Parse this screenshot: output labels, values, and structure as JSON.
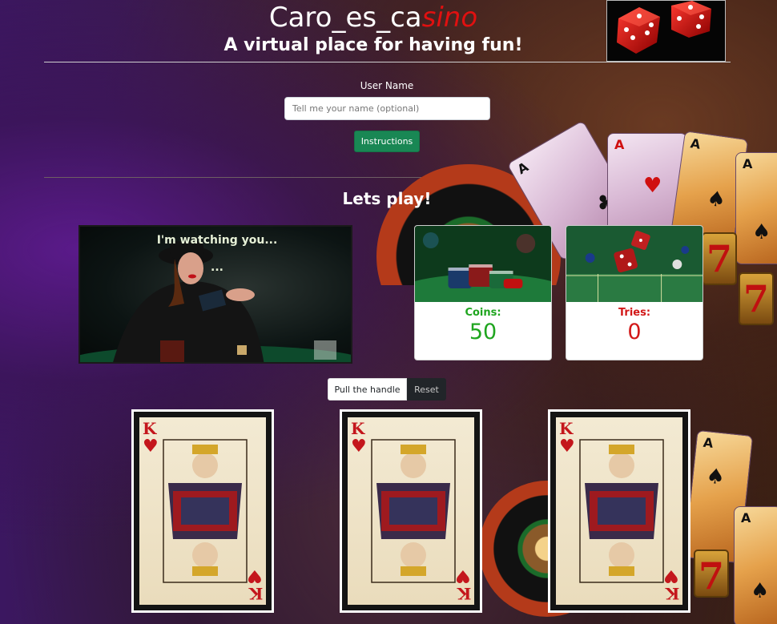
{
  "header": {
    "title_main": "Caro_es_ca",
    "title_accent": "sino",
    "subtitle": "A virtual place for having fun!"
  },
  "form": {
    "user_label": "User Name",
    "name_placeholder": "Tell me your name (optional)",
    "name_value": "",
    "instructions_button": "Instructions"
  },
  "game": {
    "heading": "Lets play!",
    "watching_line1": "I'm watching you...",
    "watching_line2": "...",
    "coins_label": "Coins:",
    "coins_value": "50",
    "tries_label": "Tries:",
    "tries_value": "0",
    "pull_button": "Pull the handle",
    "reset_button": "Reset"
  },
  "slot_cards": [
    {
      "rank": "K",
      "suit": "♥"
    },
    {
      "rank": "K",
      "suit": "♥"
    },
    {
      "rank": "K",
      "suit": "♥"
    }
  ],
  "decor_cards": [
    {
      "rank": "A",
      "suit": "♥"
    },
    {
      "rank": "A",
      "suit": "♣"
    },
    {
      "rank": "A",
      "suit": "♠"
    },
    {
      "rank": "A",
      "suit": "♠"
    }
  ],
  "slot_symbol": "7",
  "colors": {
    "accent_red": "#e01010",
    "success_green": "#198754",
    "coins_green": "#1fa51f",
    "tries_red": "#d21818",
    "reset_dark": "#212529"
  },
  "icons": [
    "dice-icon",
    "roulette-wheel",
    "poker-chips",
    "playing-card"
  ]
}
